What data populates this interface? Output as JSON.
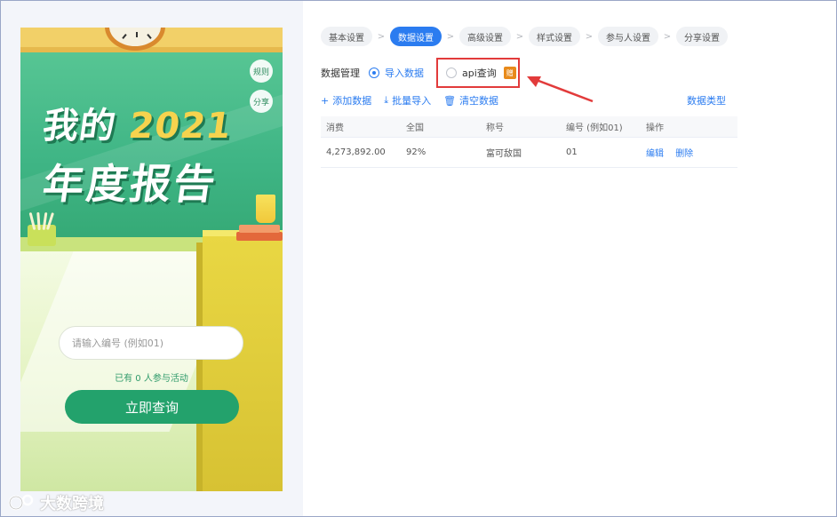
{
  "preview": {
    "title_line1_prefix": "我的 ",
    "title_year": "2021",
    "title_line2": "年度报告",
    "rules_button": "规则",
    "share_button": "分享",
    "input_placeholder": "请输入编号 (例如01)",
    "participants_text": "已有 0 人参与活动",
    "query_button": "立即查询"
  },
  "watermark": {
    "text": "大数跨境"
  },
  "steps": [
    {
      "label": "基本设置",
      "active": false
    },
    {
      "label": "数据设置",
      "active": true
    },
    {
      "label": "高级设置",
      "active": false
    },
    {
      "label": "样式设置",
      "active": false
    },
    {
      "label": "参与人设置",
      "active": false
    },
    {
      "label": "分享设置",
      "active": false
    }
  ],
  "data_management": {
    "label": "数据管理",
    "option_import": "导入数据",
    "option_api": "api查询",
    "api_tag": "赠",
    "selected": "导入数据"
  },
  "actions": {
    "add": "添加数据",
    "batch_import": "批量导入",
    "clear": "清空数据",
    "data_type": "数据类型"
  },
  "table": {
    "headers": [
      "消费",
      "全国",
      "称号",
      "编号 (例如01)",
      "操作"
    ],
    "rows": [
      {
        "cells": [
          "4,273,892.00",
          "92%",
          "富可敌国",
          "01"
        ],
        "ops": [
          "编辑",
          "删除"
        ]
      }
    ]
  },
  "colors": {
    "accent": "#2b7cf0",
    "highlight_box": "#e23b3b",
    "preview_green": "#23a26c"
  },
  "icons": {
    "add": "plus-icon",
    "batch_import": "download-icon",
    "clear": "trash-icon",
    "arrow": "red-arrow-icon"
  }
}
